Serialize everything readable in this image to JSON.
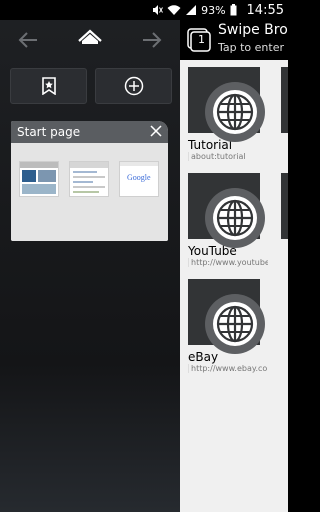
{
  "status_bar": {
    "battery": "93%",
    "time": "14:55"
  },
  "tabs_panel": {
    "tab_title": "Start page",
    "thumb_google": "Google"
  },
  "header": {
    "tab_count": "1",
    "title": "Swipe Brow",
    "subtitle": "Tap to enter a"
  },
  "bookmarks": [
    {
      "label": "Tutorial",
      "url": "about:tutorial"
    },
    {
      "label": "YouTube",
      "url": "http://www.youtube..."
    },
    {
      "label": "eBay",
      "url": "http://www.ebay.co..."
    }
  ],
  "colors": {
    "panel_dark": "#1e2023",
    "tab_header": "#5a5d61",
    "bookmark_bg": "#323436",
    "content_bg": "#f0f0f0"
  }
}
